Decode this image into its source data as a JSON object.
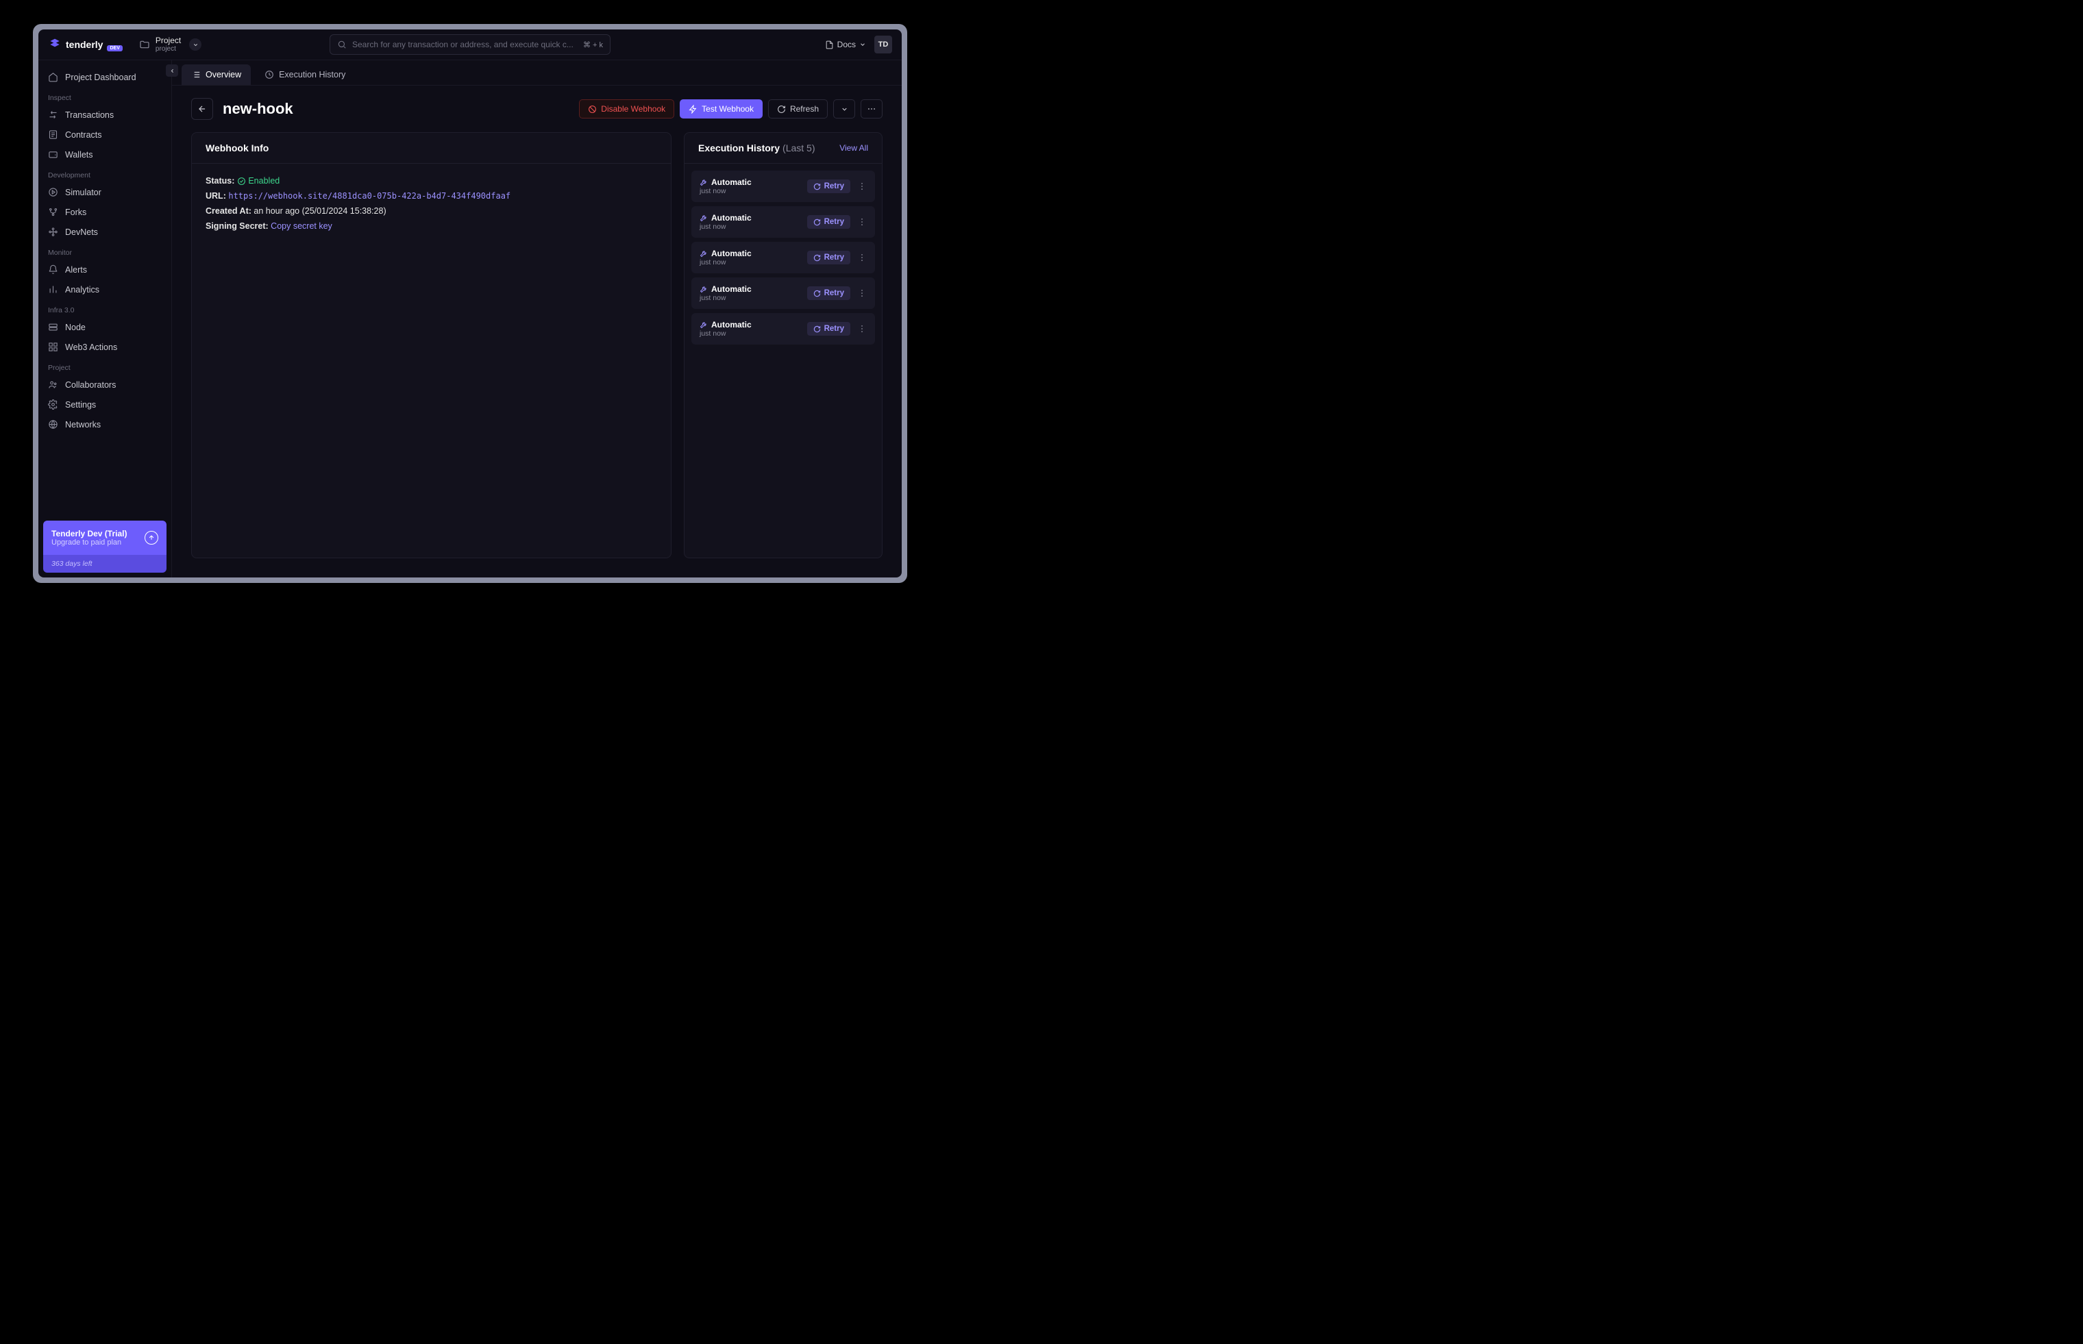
{
  "brand": {
    "name": "tenderly",
    "badge": "DEV"
  },
  "project": {
    "name": "Project",
    "slug": "project"
  },
  "search": {
    "placeholder": "Search for any transaction or address, and execute quick c...",
    "shortcut": "⌘ + k"
  },
  "topbar": {
    "docs": "Docs",
    "avatar": "TD"
  },
  "sidebar": {
    "dashboard": "Project Dashboard",
    "groups": [
      {
        "heading": "Inspect",
        "items": [
          {
            "label": "Transactions"
          },
          {
            "label": "Contracts"
          },
          {
            "label": "Wallets"
          }
        ]
      },
      {
        "heading": "Development",
        "items": [
          {
            "label": "Simulator"
          },
          {
            "label": "Forks"
          },
          {
            "label": "DevNets"
          }
        ]
      },
      {
        "heading": "Monitor",
        "items": [
          {
            "label": "Alerts"
          },
          {
            "label": "Analytics"
          }
        ]
      },
      {
        "heading": "Infra 3.0",
        "items": [
          {
            "label": "Node"
          },
          {
            "label": "Web3 Actions"
          }
        ]
      },
      {
        "heading": "Project",
        "items": [
          {
            "label": "Collaborators"
          },
          {
            "label": "Settings"
          },
          {
            "label": "Networks"
          }
        ]
      }
    ],
    "upgrade": {
      "title": "Tenderly Dev (Trial)",
      "subtitle": "Upgrade to paid plan",
      "remaining": "363 days left"
    }
  },
  "tabs": {
    "overview": "Overview",
    "history": "Execution History"
  },
  "page": {
    "title": "new-hook",
    "actions": {
      "disable": "Disable Webhook",
      "test": "Test Webhook",
      "refresh": "Refresh"
    }
  },
  "info": {
    "heading": "Webhook Info",
    "status_label": "Status:",
    "status_value": "Enabled",
    "url_label": "URL:",
    "url_value": "https://webhook.site/4881dca0-075b-422a-b4d7-434f490dfaaf",
    "created_label": "Created At:",
    "created_value": "an hour ago (25/01/2024 15:38:28)",
    "secret_label": "Signing Secret:",
    "secret_link": "Copy secret key"
  },
  "execHistory": {
    "heading": "Execution History",
    "suffix": "(Last 5)",
    "viewAll": "View All",
    "retry": "Retry",
    "items": [
      {
        "type": "Automatic",
        "time": "just now"
      },
      {
        "type": "Automatic",
        "time": "just now"
      },
      {
        "type": "Automatic",
        "time": "just now"
      },
      {
        "type": "Automatic",
        "time": "just now"
      },
      {
        "type": "Automatic",
        "time": "just now"
      }
    ]
  }
}
